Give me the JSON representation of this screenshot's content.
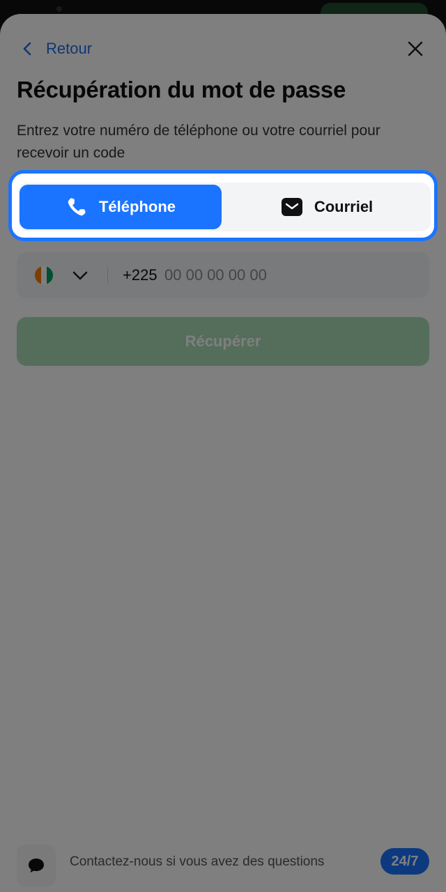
{
  "nav": {
    "back_label": "Retour"
  },
  "page": {
    "title": "Récupération du mot de passe",
    "subtitle": "Entrez votre numéro de téléphone ou votre courriel pour recevoir un code"
  },
  "method_toggle": {
    "phone_label": "Téléphone",
    "email_label": "Courriel",
    "selected": "phone"
  },
  "phone_field": {
    "country": "Côte d'Ivoire",
    "flag_colors": [
      "#f77f00",
      "#ffffff",
      "#009e60"
    ],
    "dial_code": "+225",
    "placeholder": "00 00 00 00 00",
    "value": ""
  },
  "submit": {
    "label": "Récupérer",
    "enabled": false
  },
  "footer": {
    "help_text": "Contactez-nous si vous avez des questions",
    "badge": "24/7"
  },
  "colors": {
    "accent": "#1a74ff",
    "link": "#1e6fe0",
    "submit_disabled": "#a9dcb6"
  }
}
